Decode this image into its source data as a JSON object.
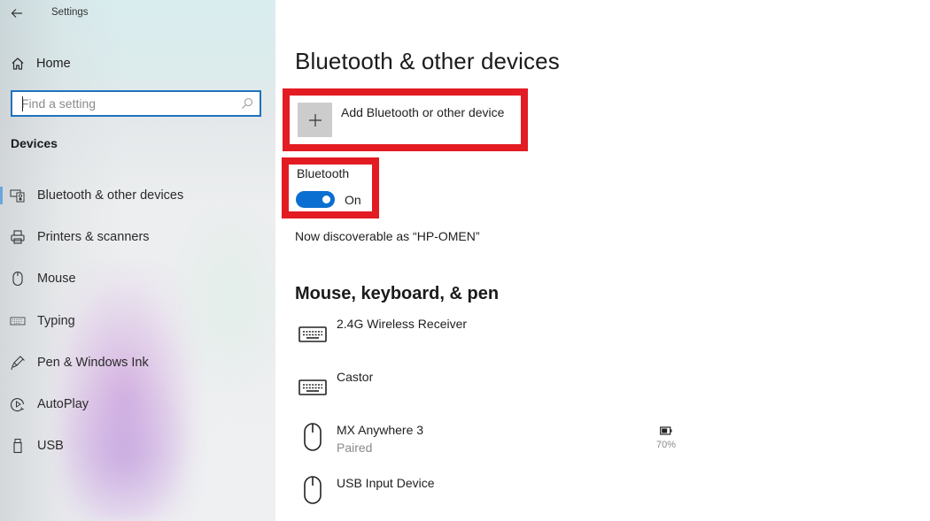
{
  "window": {
    "app_title": "Settings",
    "back_icon": "arrow-left-icon"
  },
  "sidebar": {
    "home": {
      "label": "Home",
      "icon": "home-icon"
    },
    "search": {
      "placeholder": "Find a setting",
      "value": "",
      "icon": "search-icon"
    },
    "section_title": "Devices",
    "items": [
      {
        "label": "Bluetooth & other devices",
        "icon": "bluetooth-devices-icon",
        "active": true
      },
      {
        "label": "Printers & scanners",
        "icon": "printer-icon",
        "active": false
      },
      {
        "label": "Mouse",
        "icon": "mouse-icon",
        "active": false
      },
      {
        "label": "Typing",
        "icon": "keyboard-icon",
        "active": false
      },
      {
        "label": "Pen & Windows Ink",
        "icon": "pen-icon",
        "active": false
      },
      {
        "label": "AutoPlay",
        "icon": "autoplay-icon",
        "active": false
      },
      {
        "label": "USB",
        "icon": "usb-icon",
        "active": false
      }
    ],
    "accent_color": "#1e73be"
  },
  "main": {
    "page_title": "Bluetooth & other devices",
    "add_device": {
      "label": "Add Bluetooth or other device",
      "icon": "plus-icon"
    },
    "bluetooth": {
      "label": "Bluetooth",
      "state": true,
      "state_label": "On",
      "toggle_color": "#0a6fd0"
    },
    "discoverable_text": "Now discoverable as “HP-OMEN”",
    "section_title": "Mouse, keyboard, & pen",
    "devices": [
      {
        "name": "2.4G Wireless Receiver",
        "status": "",
        "icon": "keyboard-icon"
      },
      {
        "name": "Castor",
        "status": "",
        "icon": "keyboard-icon"
      },
      {
        "name": "MX Anywhere 3",
        "status": "Paired",
        "icon": "mouse-icon",
        "battery": "70%",
        "battery_level": 0.7
      },
      {
        "name": "USB Input Device",
        "status": "",
        "icon": "mouse-icon"
      }
    ],
    "highlight_color": "#e31b23"
  }
}
